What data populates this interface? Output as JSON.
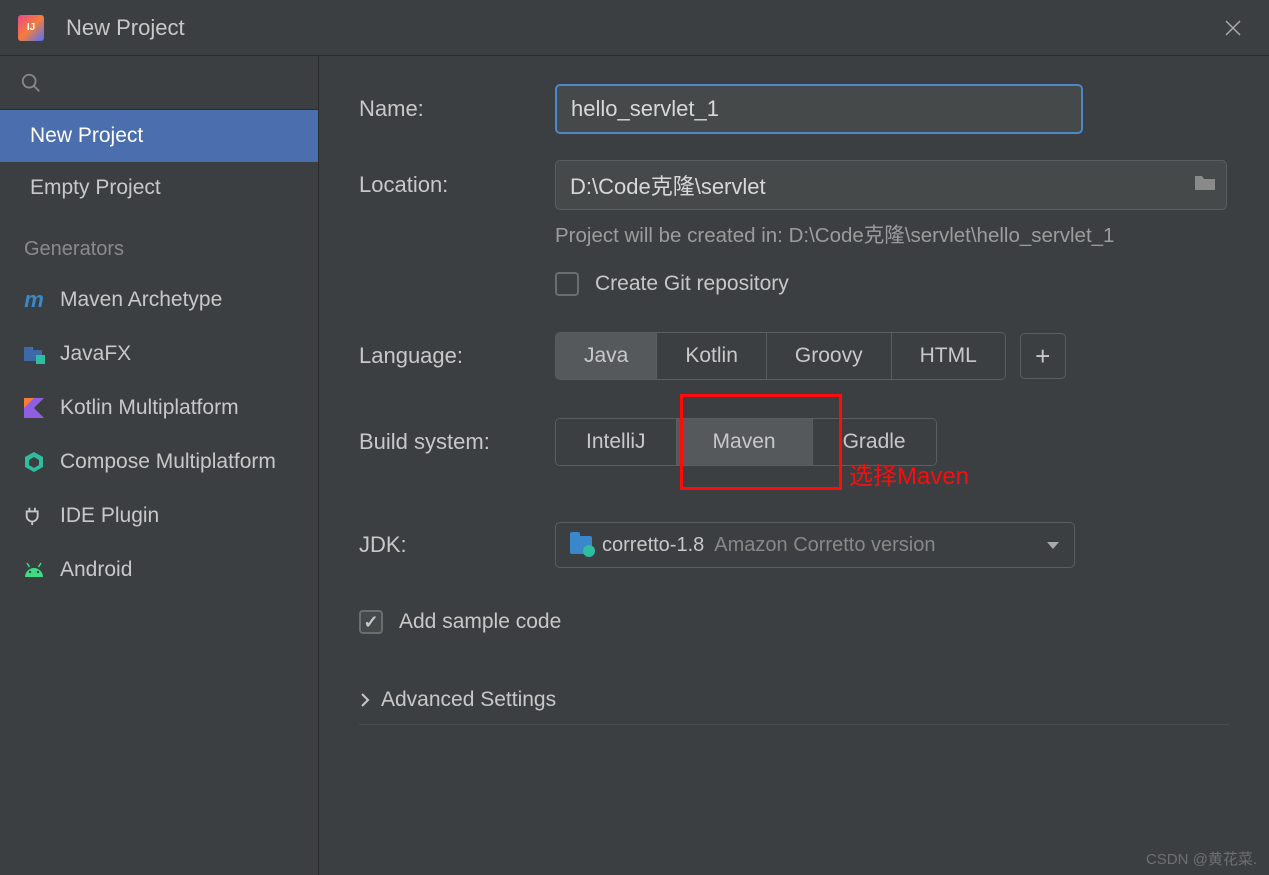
{
  "window": {
    "title": "New Project"
  },
  "sidebar": {
    "items": [
      {
        "label": "New Project"
      },
      {
        "label": "Empty Project"
      }
    ],
    "generators_title": "Generators",
    "generators": [
      {
        "label": "Maven Archetype"
      },
      {
        "label": "JavaFX"
      },
      {
        "label": "Kotlin Multiplatform"
      },
      {
        "label": "Compose Multiplatform"
      },
      {
        "label": "IDE Plugin"
      },
      {
        "label": "Android"
      }
    ]
  },
  "form": {
    "name_label": "Name:",
    "name_value": "hello_servlet_1",
    "location_label": "Location:",
    "location_value": "D:\\Code克隆\\servlet",
    "location_hint": "Project will be created in: D:\\Code克隆\\servlet\\hello_servlet_1",
    "create_git_label": "Create Git repository",
    "language_label": "Language:",
    "languages": [
      "Java",
      "Kotlin",
      "Groovy",
      "HTML"
    ],
    "build_label": "Build system:",
    "builds": [
      "IntelliJ",
      "Maven",
      "Gradle"
    ],
    "jdk_label": "JDK:",
    "jdk_value": "corretto-1.8",
    "jdk_detail": "Amazon Corretto version",
    "sample_label": "Add sample code",
    "advanced_label": "Advanced Settings"
  },
  "annotation": {
    "text": "选择Maven"
  },
  "watermark": "CSDN @黄花菜."
}
